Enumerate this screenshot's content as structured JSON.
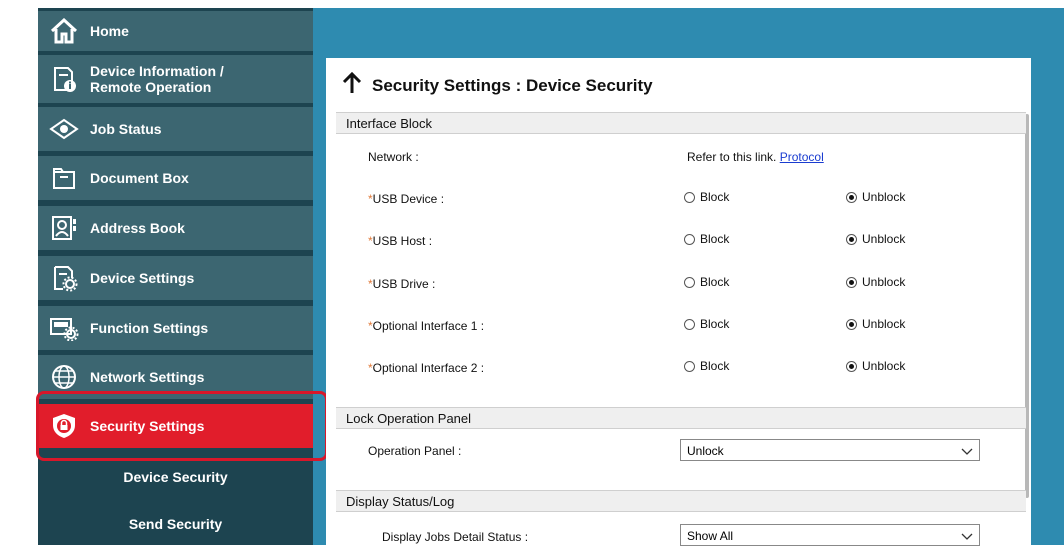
{
  "sidebar": {
    "items": [
      {
        "label1": "Home",
        "label2": "",
        "icon": "home-icon"
      },
      {
        "label1": "Device Information /",
        "label2": "Remote Operation",
        "icon": "device-info-icon"
      },
      {
        "label1": "Job Status",
        "label2": "",
        "icon": "eye-icon"
      },
      {
        "label1": "Document Box",
        "label2": "",
        "icon": "folder-icon"
      },
      {
        "label1": "Address Book",
        "label2": "",
        "icon": "contact-icon"
      },
      {
        "label1": "Device Settings",
        "label2": "",
        "icon": "device-gear-icon"
      },
      {
        "label1": "Function Settings",
        "label2": "",
        "icon": "printer-gear-icon"
      },
      {
        "label1": "Network Settings",
        "label2": "",
        "icon": "globe-icon"
      },
      {
        "label1": "Security Settings",
        "label2": "",
        "icon": "shield-lock-icon"
      }
    ],
    "sub_items": [
      "Device Security",
      "Send Security"
    ]
  },
  "main": {
    "title": "Security Settings : Device Security",
    "sections": {
      "interface_block": "Interface Block",
      "lock_panel": "Lock Operation Panel",
      "display_status": "Display Status/Log"
    },
    "network": {
      "label": "Network :",
      "text": "Refer to this link.",
      "link": "Protocol"
    },
    "radio_rows": [
      {
        "label": "USB Device :",
        "block": "Block",
        "unblock": "Unblock"
      },
      {
        "label": "USB Host :",
        "block": "Block",
        "unblock": "Unblock"
      },
      {
        "label": "USB Drive :",
        "block": "Block",
        "unblock": "Unblock"
      },
      {
        "label": "Optional Interface 1 :",
        "block": "Block",
        "unblock": "Unblock"
      },
      {
        "label": "Optional Interface 2 :",
        "block": "Block",
        "unblock": "Unblock"
      }
    ],
    "operation_panel": {
      "label": "Operation Panel :",
      "value": "Unlock"
    },
    "jobs_detail": {
      "label": "Display Jobs Detail Status :",
      "value": "Show All"
    },
    "required_mark": "*"
  },
  "colors": {
    "active": "#e11d2b",
    "nav": "#3c6671",
    "sidebar": "#1d4450",
    "link": "#1a3cd0"
  }
}
